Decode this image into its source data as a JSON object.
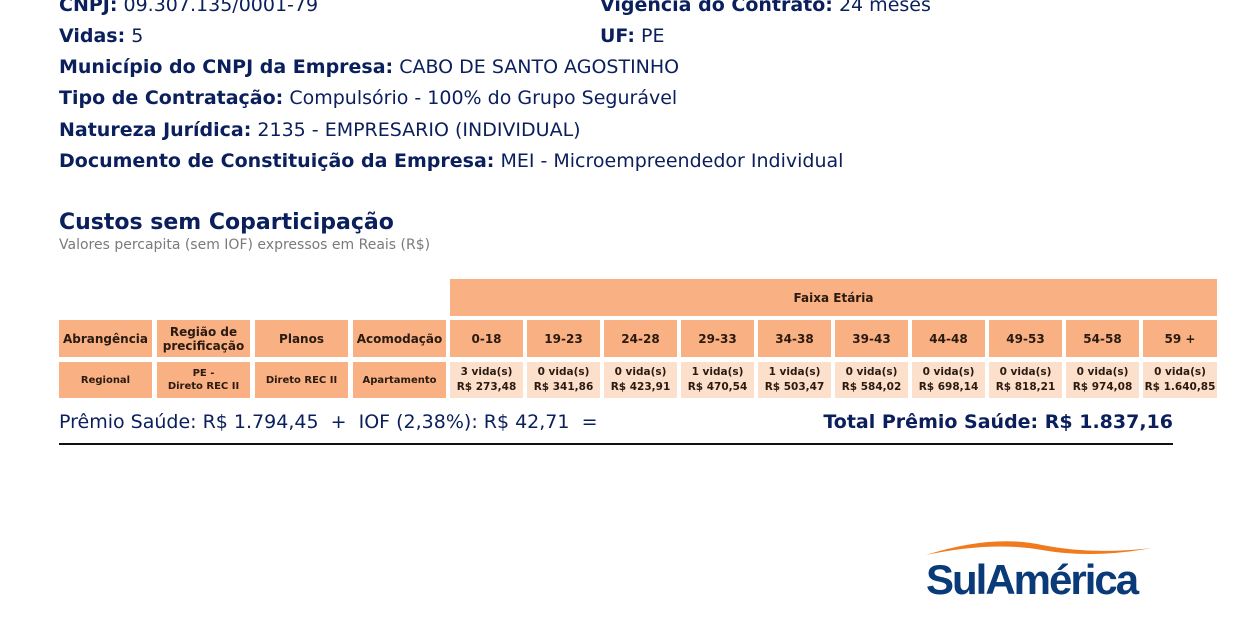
{
  "info": {
    "cnpj_label": "CNPJ:",
    "cnpj_value": "09.307.135/0001-79",
    "vigencia_label": "Vigência do Contrato:",
    "vigencia_value": "24 meses",
    "vidas_label": "Vidas:",
    "vidas_value": "5",
    "uf_label": "UF:",
    "uf_value": "PE",
    "municipio_label": "Município do CNPJ da Empresa:",
    "municipio_value": "CABO DE SANTO AGOSTINHO",
    "tipo_label": "Tipo de Contratação:",
    "tipo_value": "Compulsório - 100% do Grupo Segurável",
    "natureza_label": "Natureza Jurídica:",
    "natureza_value": "2135 - EMPRESARIO (INDIVIDUAL)",
    "documento_label": "Documento de Constituição da Empresa:",
    "documento_value": "MEI - Microempreendedor Individual"
  },
  "section": {
    "title": "Custos sem Coparticipação",
    "subtitle": "Valores percapita (sem IOF) expressos em Reais (R$)"
  },
  "table": {
    "faixa_header": "Faixa Etária",
    "headers": {
      "abrangencia": "Abrangência",
      "regiao_line1": "Região de",
      "regiao_line2": "precificação",
      "planos": "Planos",
      "acomodacao": "Acomodação"
    },
    "row": {
      "abrangencia": "Regional",
      "regiao_line1": "PE -",
      "regiao_line2": "Direto REC II",
      "planos": "Direto REC II",
      "acomodacao": "Apartamento"
    },
    "age_bands": [
      {
        "label": "0-18",
        "lives": "3 vida(s)",
        "price": "R$ 273,48"
      },
      {
        "label": "19-23",
        "lives": "0 vida(s)",
        "price": "R$ 341,86"
      },
      {
        "label": "24-28",
        "lives": "0 vida(s)",
        "price": "R$ 423,91"
      },
      {
        "label": "29-33",
        "lives": "1 vida(s)",
        "price": "R$ 470,54"
      },
      {
        "label": "34-38",
        "lives": "1 vida(s)",
        "price": "R$ 503,47"
      },
      {
        "label": "39-43",
        "lives": "0 vida(s)",
        "price": "R$ 584,02"
      },
      {
        "label": "44-48",
        "lives": "0 vida(s)",
        "price": "R$ 698,14"
      },
      {
        "label": "49-53",
        "lives": "0 vida(s)",
        "price": "R$ 818,21"
      },
      {
        "label": "54-58",
        "lives": "0 vida(s)",
        "price": "R$ 974,08"
      },
      {
        "label": "59 +",
        "lives": "0 vida(s)",
        "price": "R$ 1.640,85"
      }
    ]
  },
  "summary": {
    "premio_text": "Prêmio Saúde: R$ 1.794,45  +  IOF (2,38%): R$ 42,71  =",
    "total_text": "Total Prêmio Saúde: R$ 1.837,16"
  },
  "logo": {
    "text": "SulAmérica",
    "swoosh_color": "#f07a1e",
    "text_color": "#0b3a78"
  },
  "colors": {
    "header_bg": "#f9b183",
    "value_bg": "#fde0cc",
    "text_navy": "#0a1f5c"
  }
}
